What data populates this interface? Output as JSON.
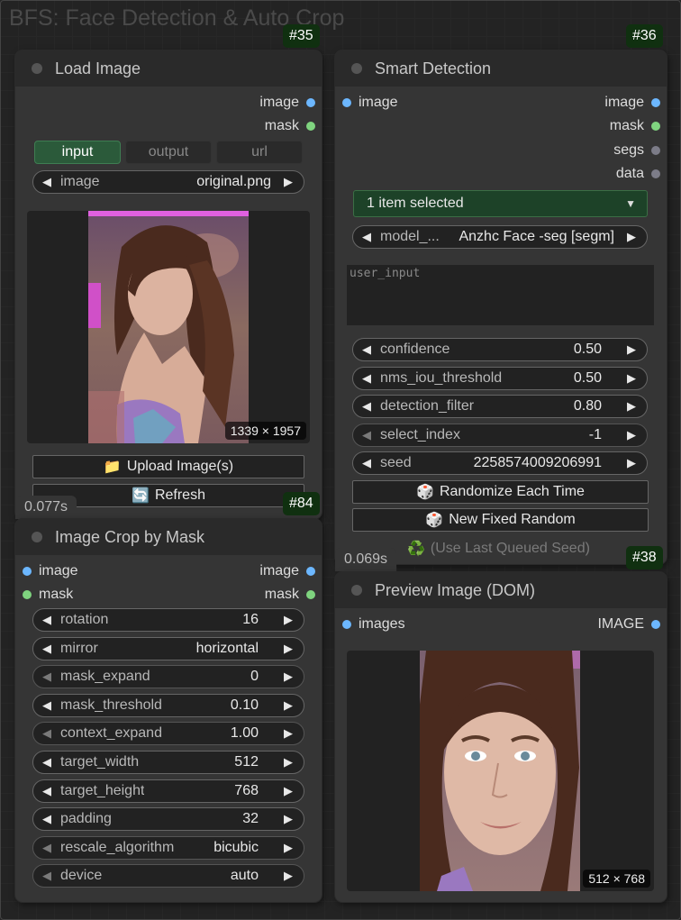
{
  "group": {
    "title": "BFS: Face Detection & Auto Crop"
  },
  "load_image": {
    "id": "#35",
    "title": "Load Image",
    "outputs": [
      "image",
      "mask"
    ],
    "tabs": [
      "input",
      "output",
      "url"
    ],
    "image_widget": {
      "label": "image",
      "value": "original.png"
    },
    "image_size": "1339 × 1957",
    "upload_button": {
      "icon": "📁",
      "label": "Upload Image(s)"
    },
    "refresh_button": {
      "icon": "🔄",
      "label": "Refresh"
    },
    "timing": "0.077s"
  },
  "smart_detection": {
    "id": "#36",
    "title": "Smart Detection",
    "inputs": [
      "image"
    ],
    "outputs": [
      "image",
      "mask",
      "segs",
      "data"
    ],
    "dropdown": "1 item selected",
    "model": {
      "label": "model_...",
      "value": "Anzhc Face -seg [segm]"
    },
    "user_input_placeholder": "user_input",
    "widgets": [
      {
        "label": "confidence",
        "value": "0.50"
      },
      {
        "label": "nms_iou_threshold",
        "value": "0.50"
      },
      {
        "label": "detection_filter",
        "value": "0.80"
      },
      {
        "label": "select_index",
        "value": "-1"
      },
      {
        "label": "seed",
        "value": "2258574009206991"
      }
    ],
    "randomize_button": {
      "icon": "🎲",
      "label": "Randomize Each Time"
    },
    "fixed_random_button": {
      "icon": "🎲",
      "label": "New Fixed Random"
    },
    "last_seed_button": {
      "icon": "♻️",
      "label": "(Use Last Queued Seed)"
    },
    "timing": "0.069s"
  },
  "image_crop": {
    "id": "#84",
    "title": "Image Crop by Mask",
    "inputs": [
      "image",
      "mask"
    ],
    "outputs": [
      "image",
      "mask"
    ],
    "widgets": [
      {
        "label": "rotation",
        "value": "16"
      },
      {
        "label": "mirror",
        "value": "horizontal"
      },
      {
        "label": "mask_expand",
        "value": "0"
      },
      {
        "label": "mask_threshold",
        "value": "0.10"
      },
      {
        "label": "context_expand",
        "value": "1.00"
      },
      {
        "label": "target_width",
        "value": "512"
      },
      {
        "label": "target_height",
        "value": "768"
      },
      {
        "label": "padding",
        "value": "32"
      },
      {
        "label": "rescale_algorithm",
        "value": "bicubic"
      },
      {
        "label": "device",
        "value": "auto"
      }
    ]
  },
  "preview_image": {
    "id": "#38",
    "title": "Preview Image (DOM)",
    "inputs": [
      "images"
    ],
    "outputs": [
      "IMAGE"
    ],
    "image_size": "512 × 768"
  },
  "colors": {
    "input_tab_active": "#2b5a3a",
    "badge": "#103010",
    "slot_image": "#6cb7ff",
    "slot_mask": "#7fd47f"
  }
}
